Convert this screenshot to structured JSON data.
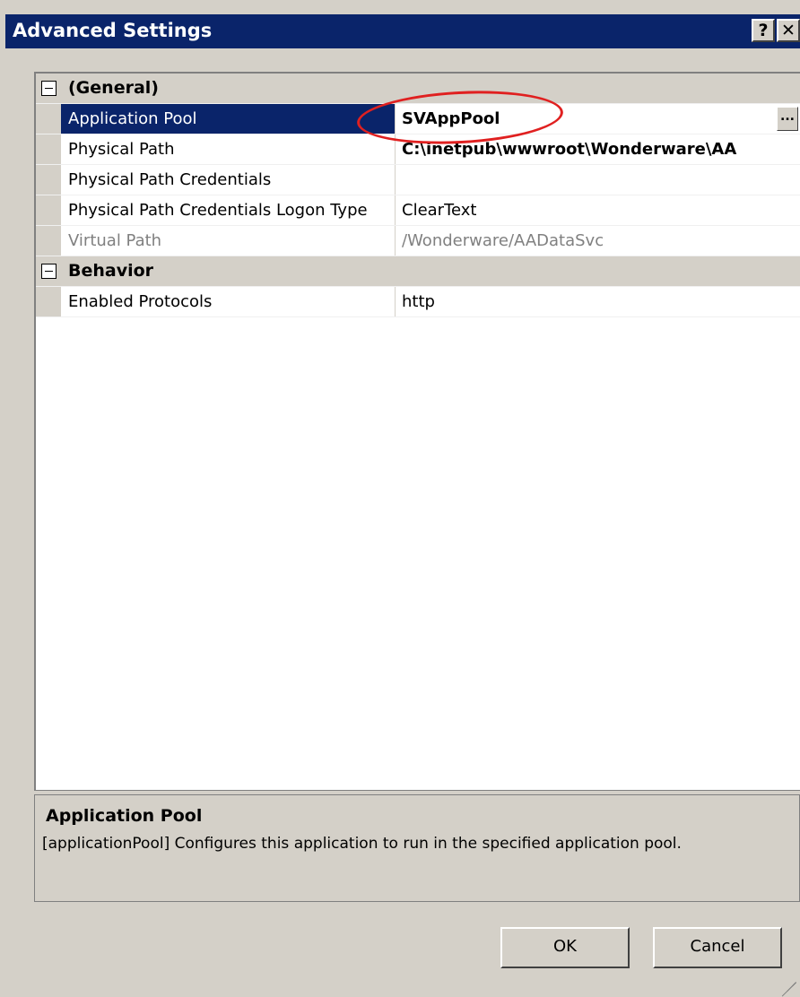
{
  "window": {
    "title": "Advanced Settings",
    "help_label": "?",
    "close_label": "✕"
  },
  "grid": {
    "categories": [
      {
        "label": "(General)",
        "properties": [
          {
            "name": "Application Pool",
            "value": "SVAppPool"
          },
          {
            "name": "Physical Path",
            "value": "C:\\inetpub\\wwwroot\\Wonderware\\AA"
          },
          {
            "name": "Physical Path Credentials",
            "value": ""
          },
          {
            "name": "Physical Path Credentials Logon Type",
            "value": "ClearText"
          },
          {
            "name": "Virtual Path",
            "value": "/Wonderware/AADataSvc"
          }
        ]
      },
      {
        "label": "Behavior",
        "properties": [
          {
            "name": "Enabled Protocols",
            "value": "http"
          }
        ]
      }
    ],
    "ellipsis_label": "..."
  },
  "description": {
    "title": "Application Pool",
    "text": "[applicationPool] Configures this application to run in the specified application pool."
  },
  "buttons": {
    "ok_label": "OK",
    "cancel_label": "Cancel"
  }
}
